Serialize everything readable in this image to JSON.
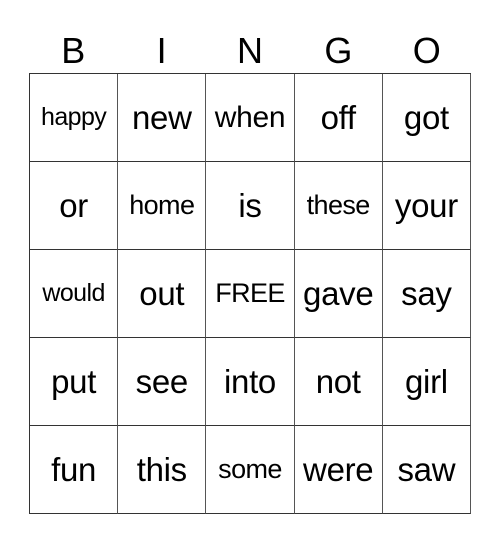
{
  "header": {
    "letters": [
      "B",
      "I",
      "N",
      "G",
      "O"
    ]
  },
  "card": {
    "rows": [
      [
        "happy",
        "new",
        "when",
        "off",
        "got"
      ],
      [
        "or",
        "home",
        "is",
        "these",
        "your"
      ],
      [
        "would",
        "out",
        "FREE",
        "gave",
        "say"
      ],
      [
        "put",
        "see",
        "into",
        "not",
        "girl"
      ],
      [
        "fun",
        "this",
        "some",
        "were",
        "saw"
      ]
    ]
  }
}
